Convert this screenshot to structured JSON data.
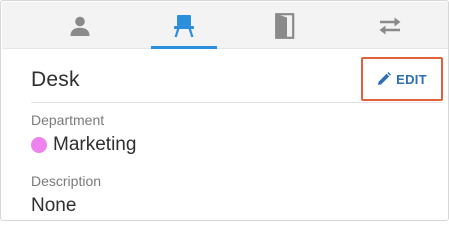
{
  "tabs": [
    {
      "icon": "person-icon",
      "active": false
    },
    {
      "icon": "desk-icon",
      "active": true
    },
    {
      "icon": "door-icon",
      "active": false
    },
    {
      "icon": "swap-arrows-icon",
      "active": false
    }
  ],
  "colors": {
    "active_tab": "#2b8fdc",
    "inactive_icon": "#8a8a8a",
    "edit_text": "#2f6eb0",
    "highlight_border": "#e0623a",
    "department_dot": "#ee82ee"
  },
  "panel": {
    "title": "Desk",
    "edit_label": "EDIT"
  },
  "fields": {
    "department": {
      "label": "Department",
      "value": "Marketing"
    },
    "description": {
      "label": "Description",
      "value": "None"
    }
  }
}
